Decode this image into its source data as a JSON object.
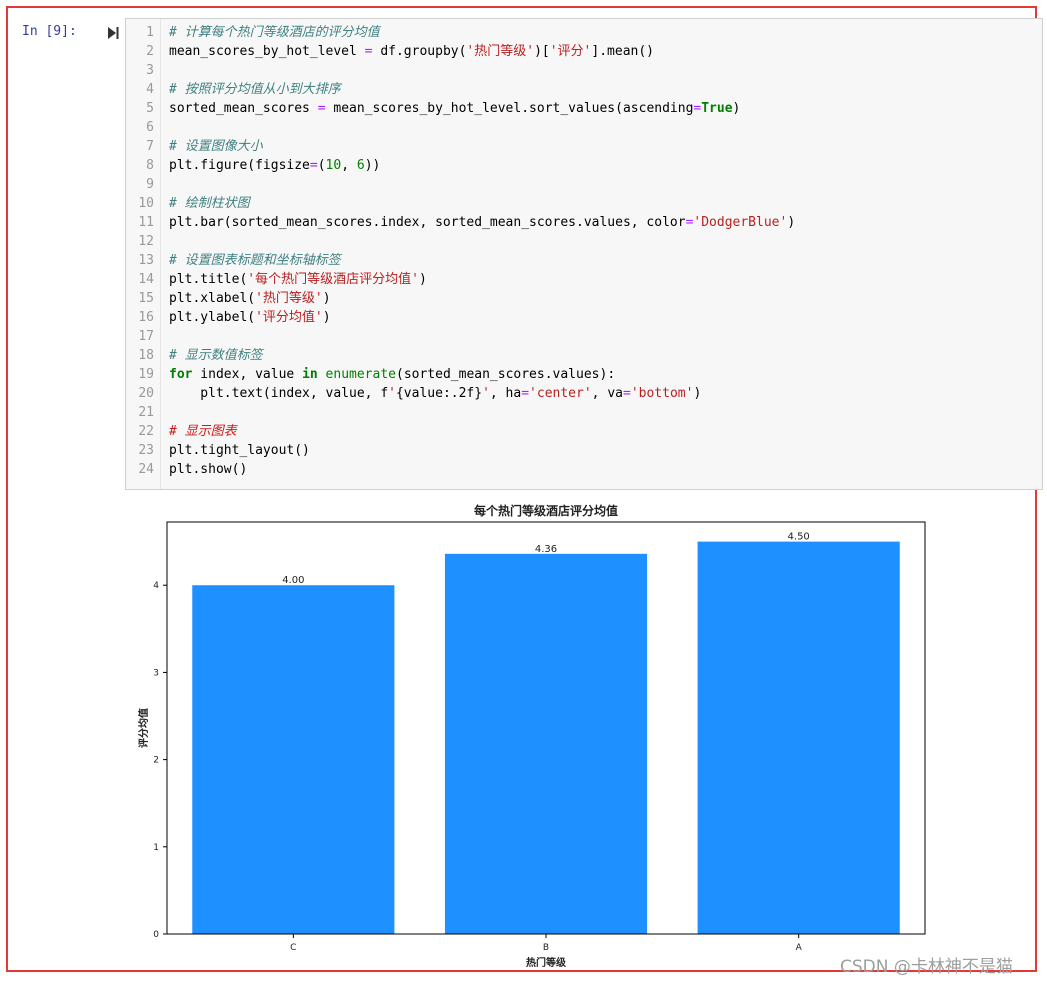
{
  "cell": {
    "prompt": "In  [9]:"
  },
  "code_lines": [
    [
      {
        "c": "cm",
        "t": "# 计算每个热门等级酒店的评分均值"
      }
    ],
    [
      {
        "c": "",
        "t": "mean_scores_by_hot_level "
      },
      {
        "c": "op",
        "t": "="
      },
      {
        "c": "",
        "t": " df.groupby("
      },
      {
        "c": "st",
        "t": "'热门等级'"
      },
      {
        "c": "",
        "t": ")["
      },
      {
        "c": "st",
        "t": "'评分'"
      },
      {
        "c": "",
        "t": "].mean()"
      }
    ],
    [],
    [
      {
        "c": "cm",
        "t": "# 按照评分均值从小到大排序"
      }
    ],
    [
      {
        "c": "",
        "t": "sorted_mean_scores "
      },
      {
        "c": "op",
        "t": "="
      },
      {
        "c": "",
        "t": " mean_scores_by_hot_level.sort_values(ascending"
      },
      {
        "c": "op",
        "t": "="
      },
      {
        "c": "kw",
        "t": "True"
      },
      {
        "c": "",
        "t": ")"
      }
    ],
    [],
    [
      {
        "c": "cm",
        "t": "# 设置图像大小"
      }
    ],
    [
      {
        "c": "",
        "t": "plt.figure(figsize"
      },
      {
        "c": "op",
        "t": "="
      },
      {
        "c": "",
        "t": "("
      },
      {
        "c": "nm",
        "t": "10"
      },
      {
        "c": "",
        "t": ", "
      },
      {
        "c": "nm",
        "t": "6"
      },
      {
        "c": "",
        "t": "))"
      }
    ],
    [],
    [
      {
        "c": "cm",
        "t": "# 绘制柱状图"
      }
    ],
    [
      {
        "c": "",
        "t": "plt.bar(sorted_mean_scores.index, sorted_mean_scores.values, color"
      },
      {
        "c": "op",
        "t": "="
      },
      {
        "c": "st",
        "t": "'DodgerBlue'"
      },
      {
        "c": "",
        "t": ")"
      }
    ],
    [],
    [
      {
        "c": "cm",
        "t": "# 设置图表标题和坐标轴标签"
      }
    ],
    [
      {
        "c": "",
        "t": "plt.title("
      },
      {
        "c": "st",
        "t": "'每个热门等级酒店评分均值'"
      },
      {
        "c": "",
        "t": ")"
      }
    ],
    [
      {
        "c": "",
        "t": "plt.xlabel("
      },
      {
        "c": "st",
        "t": "'热门等级'"
      },
      {
        "c": "",
        "t": ")"
      }
    ],
    [
      {
        "c": "",
        "t": "plt.ylabel("
      },
      {
        "c": "st",
        "t": "'评分均值'"
      },
      {
        "c": "",
        "t": ")"
      }
    ],
    [],
    [
      {
        "c": "cm",
        "t": "# 显示数值标签"
      }
    ],
    [
      {
        "c": "kw",
        "t": "for"
      },
      {
        "c": "",
        "t": " index, value "
      },
      {
        "c": "kw",
        "t": "in"
      },
      {
        "c": "",
        "t": " "
      },
      {
        "c": "nm",
        "t": "enumerate"
      },
      {
        "c": "",
        "t": "(sorted_mean_scores.values):"
      }
    ],
    [
      {
        "c": "",
        "t": "    plt.text(index, value, f"
      },
      {
        "c": "st",
        "t": "'"
      },
      {
        "c": "",
        "t": "{value:.2f}"
      },
      {
        "c": "st",
        "t": "'"
      },
      {
        "c": "",
        "t": ", ha"
      },
      {
        "c": "op",
        "t": "="
      },
      {
        "c": "st",
        "t": "'center'"
      },
      {
        "c": "",
        "t": ", va"
      },
      {
        "c": "op",
        "t": "="
      },
      {
        "c": "st",
        "t": "'bottom'"
      },
      {
        "c": "",
        "t": ")"
      }
    ],
    [],
    [
      {
        "c": "cmr",
        "t": "# 显示图表"
      }
    ],
    [
      {
        "c": "",
        "t": "plt.tight_layout()"
      }
    ],
    [
      {
        "c": "",
        "t": "plt.show()"
      }
    ]
  ],
  "chart_data": {
    "type": "bar",
    "title": "每个热门等级酒店评分均值",
    "xlabel": "热门等级",
    "ylabel": "评分均值",
    "categories": [
      "C",
      "B",
      "A"
    ],
    "values": [
      4.0,
      4.36,
      4.5
    ],
    "value_labels": [
      "4.00",
      "4.36",
      "4.50"
    ],
    "ylim": [
      0,
      4.725
    ],
    "yticks": [
      "0",
      "1",
      "2",
      "3",
      "4"
    ],
    "color": "#1E90FF",
    "grid": false
  },
  "watermark": "CSDN @卡林神不是猫"
}
